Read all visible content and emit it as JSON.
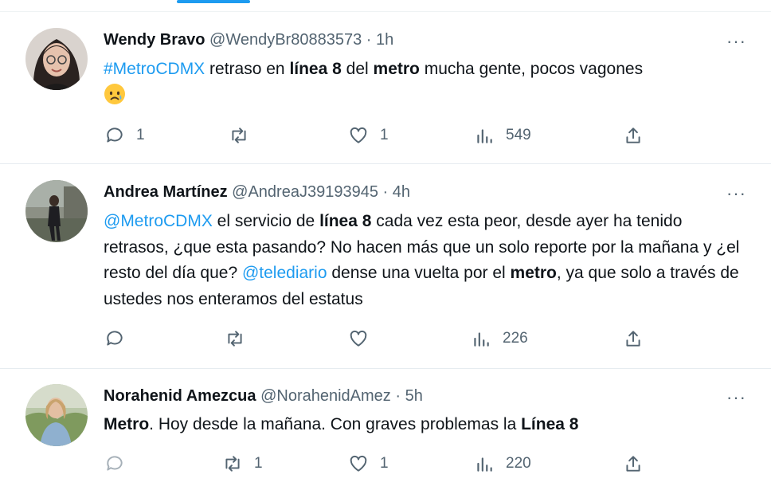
{
  "tweets": [
    {
      "name": "Wendy Bravo",
      "handle": "@WendyBr80883573",
      "dot": "·",
      "time": "1h",
      "more": "···",
      "text": {
        "t1": "#MetroCDMX",
        "t2": " retraso en ",
        "t3": "línea 8",
        "t4": " del ",
        "t5": "metro",
        "t6": " mucha gente, pocos vagones"
      },
      "emoji": "crying-face",
      "replies": "1",
      "retweets": "",
      "likes": "1",
      "views": "549"
    },
    {
      "name": "Andrea Martínez",
      "handle": "@AndreaJ39193945",
      "dot": "·",
      "time": "4h",
      "more": "···",
      "text": {
        "t1": "@MetroCDMX",
        "t2": " el servicio de ",
        "t3": "línea 8",
        "t4": " cada vez esta peor, desde ayer ha tenido retrasos, ¿que esta pasando? No hacen más que un solo reporte por la mañana y ¿el resto del día que? ",
        "t5": "@telediario",
        "t6": " dense una vuelta por el ",
        "t7": "metro",
        "t8": ", ya que solo a través de ustedes nos enteramos del estatus"
      },
      "replies": "",
      "retweets": "",
      "likes": "",
      "views": "226"
    },
    {
      "name": "Norahenid Amezcua",
      "handle": "@NorahenidAmez",
      "dot": "·",
      "time": "5h",
      "more": "···",
      "text": {
        "t1": "Metro",
        "t2": ". Hoy desde la mañana. Con graves problemas la ",
        "t3": "Línea 8"
      },
      "replies": "",
      "retweets": "1",
      "likes": "1",
      "views": "220"
    }
  ],
  "colors": {
    "link": "#1d9bf0",
    "muted": "#536471",
    "text": "#0f1419",
    "divider": "#e6ecf0"
  }
}
